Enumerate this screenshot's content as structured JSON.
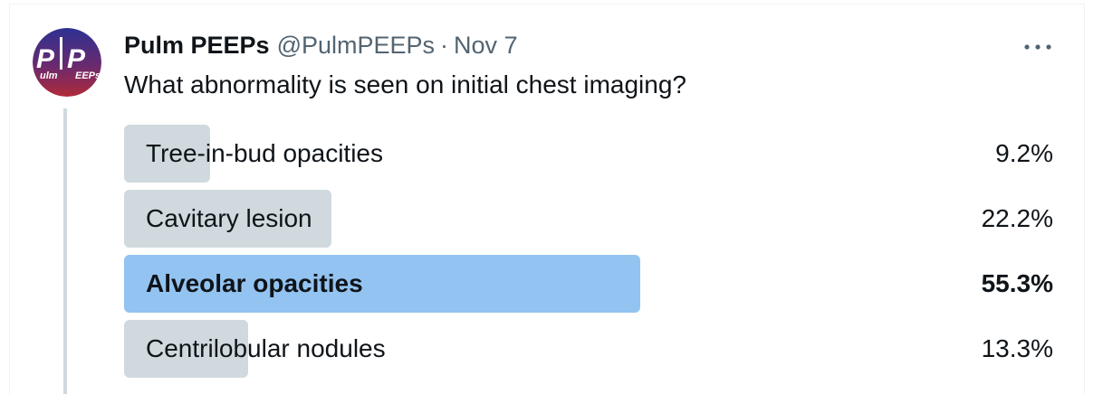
{
  "tweet": {
    "author": {
      "display_name": "Pulm PEEPs",
      "handle": "@PulmPEEPs",
      "separator": "·",
      "date": "Nov 7",
      "avatar_text": "Pulm PEEPs"
    },
    "more_icon": "more-horizontal-icon",
    "text": "What abnormality is seen on initial chest imaging?"
  },
  "poll": {
    "options": [
      {
        "label": "Tree-in-bud opacities",
        "percent_label": "9.2%",
        "percent": 9.2,
        "winner": false
      },
      {
        "label": "Cavitary lesion",
        "percent_label": "22.2%",
        "percent": 22.2,
        "winner": false
      },
      {
        "label": "Alveolar opacities",
        "percent_label": "55.3%",
        "percent": 55.3,
        "winner": true
      },
      {
        "label": "Centrilobular nodules",
        "percent_label": "13.3%",
        "percent": 13.3,
        "winner": false
      }
    ]
  },
  "colors": {
    "bar_default": "#cfd9de",
    "bar_winner": "#93c3f1",
    "secondary_text": "#536471",
    "avatar_top": "#2e3192",
    "avatar_bottom": "#b02a3a"
  }
}
